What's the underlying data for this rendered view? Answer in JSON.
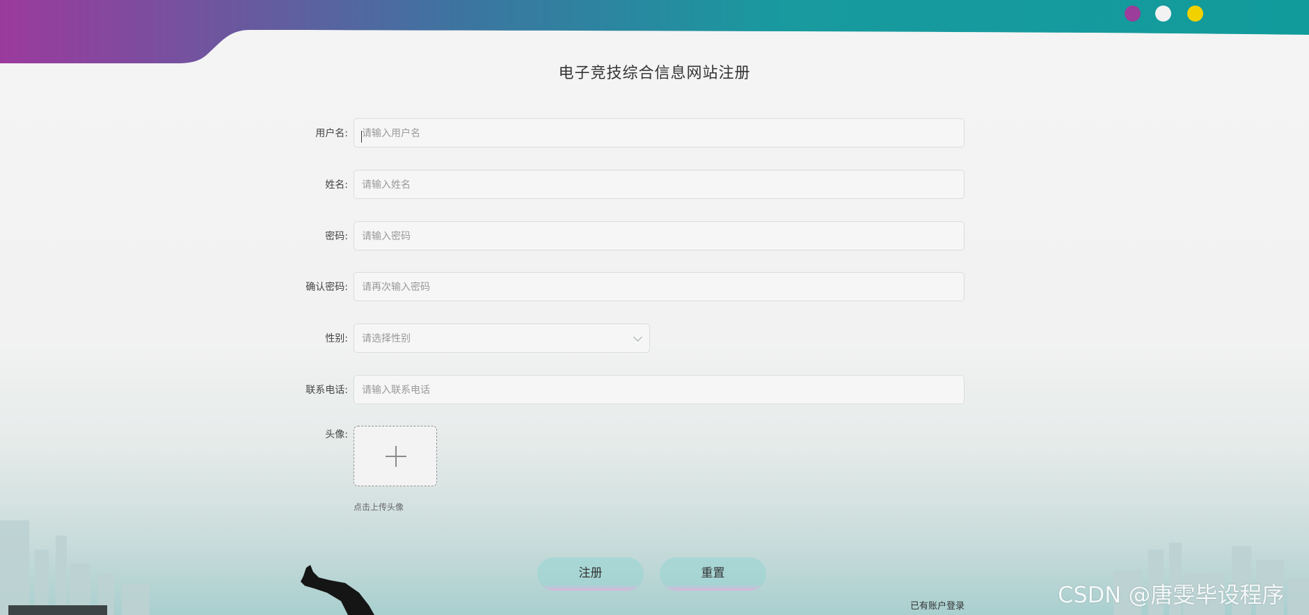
{
  "title": "电子竞技综合信息网站注册",
  "colors": {
    "accent_purple": "#9a3aa0",
    "accent_teal": "#1a9e9e",
    "dot_purple": "#9b3d9a",
    "dot_white": "#f2f2f2",
    "dot_yellow": "#f2d100",
    "button_bg": "#a6d5d4"
  },
  "form": {
    "username": {
      "label": "用户名:",
      "placeholder": "请输入用户名"
    },
    "name": {
      "label": "姓名:",
      "placeholder": "请输入姓名"
    },
    "password": {
      "label": "密码:",
      "placeholder": "请输入密码"
    },
    "confirm_password": {
      "label": "确认密码:",
      "placeholder": "请再次输入密码"
    },
    "gender": {
      "label": "性别:",
      "placeholder": "请选择性别",
      "icon": "chevron-down-icon"
    },
    "phone": {
      "label": "联系电话:",
      "placeholder": "请输入联系电话"
    },
    "avatar": {
      "label": "头像:",
      "icon": "plus-icon",
      "hint": "点击上传头像"
    }
  },
  "buttons": {
    "register": "注册",
    "reset": "重置"
  },
  "login_link": "已有账户登录",
  "watermark": "CSDN @唐雯毕设程序"
}
